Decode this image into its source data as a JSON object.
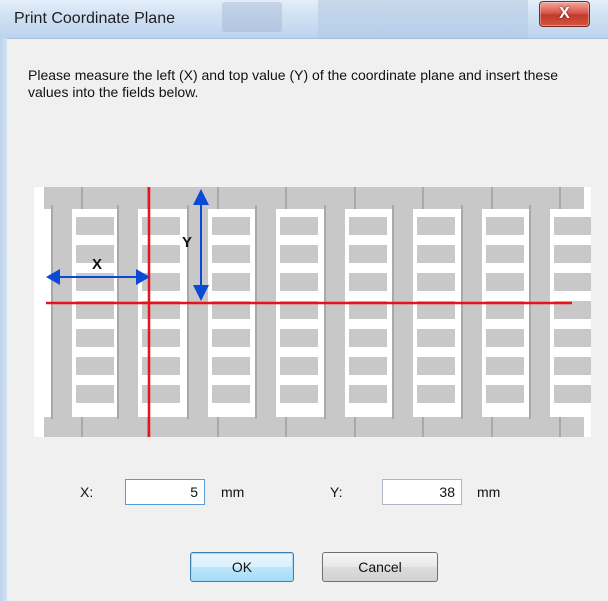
{
  "window": {
    "title": "Print Coordinate Plane",
    "close_glyph": "X",
    "close_icon": "close-icon"
  },
  "instructions": "Please measure the left (X) and top value (Y) of the coordinate plane and insert these values into the fields below.",
  "diagram": {
    "x_label": "X",
    "y_label": "Y",
    "colors": {
      "tile": "#c8c8c8",
      "edge": "#a9a9a9",
      "axis_line": "#e8121a",
      "arrow": "#0a4bd6"
    }
  },
  "fields": {
    "x": {
      "label": "X:",
      "value": "5",
      "unit": "mm"
    },
    "y": {
      "label": "Y:",
      "value": "38",
      "unit": "mm"
    }
  },
  "buttons": {
    "ok": "OK",
    "cancel": "Cancel"
  }
}
